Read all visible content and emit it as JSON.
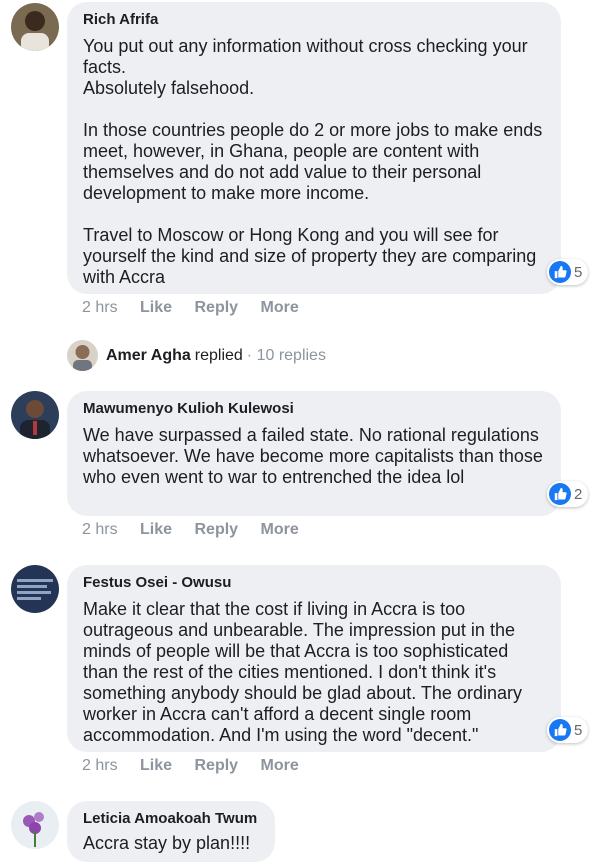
{
  "comments": [
    {
      "author": "Rich Afrifa",
      "paragraphs": [
        "You put out any information without cross checking your facts.\nAbsolutely falsehood.",
        "In those countries people do 2 or more jobs to make ends meet, however, in Ghana, people are content with themselves and do not add value to their personal development to make more income.",
        "Travel to Moscow or Hong Kong and you will see for yourself the kind and size of property they are comparing with Accra"
      ],
      "time": "2 hrs",
      "like": "Like",
      "reply": "Reply",
      "more": "More",
      "reaction_count": "5"
    },
    {
      "author": "Mawumenyo Kulioh Kulewosi",
      "paragraphs": [
        "We have surpassed a failed state. No rational regulations whatsoever. We have become more capitalists than those who even went to war to entrenched the idea lol"
      ],
      "time": "2 hrs",
      "like": "Like",
      "reply": "Reply",
      "more": "More",
      "reaction_count": "2"
    },
    {
      "author": "Festus Osei - Owusu",
      "paragraphs": [
        "Make it clear that the cost if living in Accra is too outrageous and unbearable. The impression put in the minds of people will be that Accra is too sophisticated than the rest of the cities mentioned. I don't think it's something anybody should be glad about. The ordinary worker in Accra can't afford a decent single room accommodation. And I'm using the word \"decent.\""
      ],
      "time": "2 hrs",
      "like": "Like",
      "reply": "Reply",
      "more": "More",
      "reaction_count": "5"
    },
    {
      "author": "Leticia Amoakoah Twum",
      "paragraphs": [
        "Accra stay by plan!!!!"
      ]
    }
  ],
  "replies_summary": {
    "name": "Amer Agha",
    "verb": "replied",
    "count": "· 10 replies"
  },
  "colors": {
    "bubble": "#eeeff2",
    "like_blue": "#1877f2",
    "meta": "#8d949e"
  },
  "icons": [
    "like-thumb-icon"
  ]
}
